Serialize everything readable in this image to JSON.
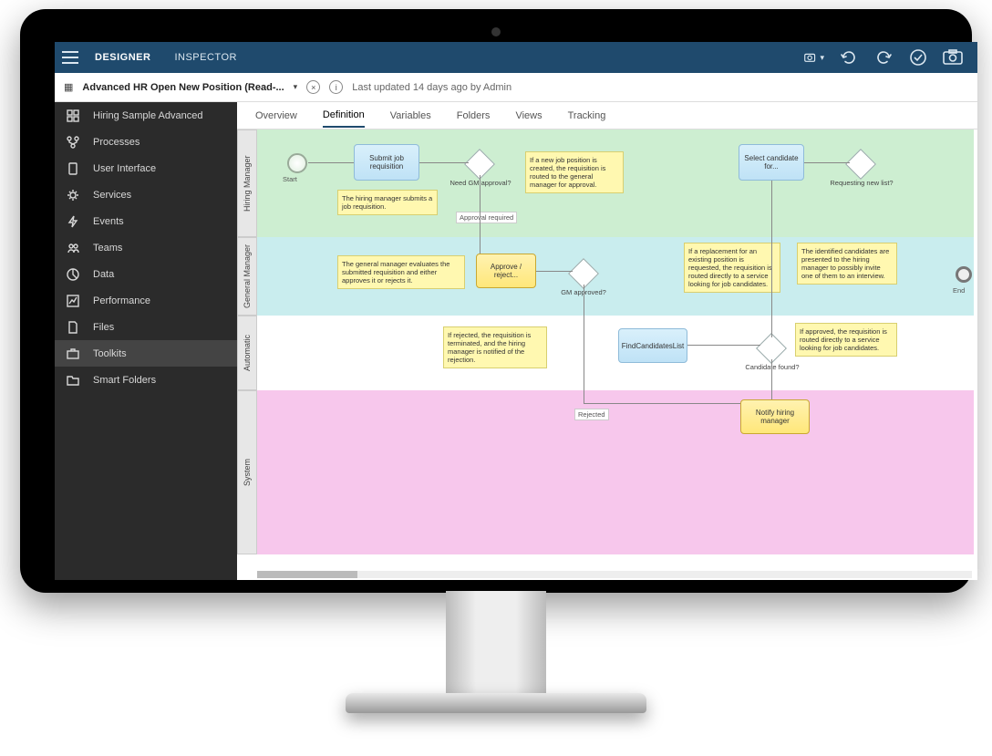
{
  "topbar": {
    "designer": "DESIGNER",
    "inspector": "INSPECTOR"
  },
  "subheader": {
    "title": "Advanced HR Open New Position (Read-...",
    "status": "Last updated 14 days ago by Admin"
  },
  "sidebar": {
    "items": [
      {
        "label": "Hiring Sample Advanced",
        "icon": "grid"
      },
      {
        "label": "Processes",
        "icon": "flow"
      },
      {
        "label": "User Interface",
        "icon": "device"
      },
      {
        "label": "Services",
        "icon": "gear"
      },
      {
        "label": "Events",
        "icon": "bolt"
      },
      {
        "label": "Teams",
        "icon": "people"
      },
      {
        "label": "Data",
        "icon": "pie"
      },
      {
        "label": "Performance",
        "icon": "chart"
      },
      {
        "label": "Files",
        "icon": "file"
      },
      {
        "label": "Toolkits",
        "icon": "briefcase"
      },
      {
        "label": "Smart Folders",
        "icon": "folder"
      }
    ]
  },
  "tabs": [
    "Overview",
    "Definition",
    "Variables",
    "Folders",
    "Views",
    "Tracking"
  ],
  "active_tab": "Definition",
  "lanes": {
    "l1": "Hiring Manager",
    "l2": "General Manager",
    "l3": "Automatic",
    "l4": "System"
  },
  "diagram": {
    "start": "Start",
    "submit": "Submit job requisition",
    "note_submit": "The hiring manager submits a job requisition.",
    "need_gm": "Need GM approval?",
    "approval_req": "Approval required",
    "note_newjob": "If a new job position is created, the requisition is routed to the general manager for approval.",
    "select_cand": "Select candidate for...",
    "req_new": "Requesting new list?",
    "note_gm_eval": "The general manager evaluates the submitted requisition and either approves it or rejects it.",
    "approve": "Approve / reject...",
    "gm_approved": "GM approved?",
    "note_replace": "If a replacement for an existing position is requested, the requisition is routed directly to a service looking for job candidates.",
    "note_identified": "The identified candidates are presented to the hiring manager to possibly invite one of them to an interview.",
    "end": "End",
    "note_rejected": "If rejected, the requisition is terminated, and the hiring manager is notified of the rejection.",
    "find_cand": "FindCandidatesList",
    "cand_found": "Candidate found?",
    "note_approved": "If approved, the requisition is routed directly to a service looking for job candidates.",
    "rejected_lbl": "Rejected",
    "notify": "Notify hiring manager"
  }
}
